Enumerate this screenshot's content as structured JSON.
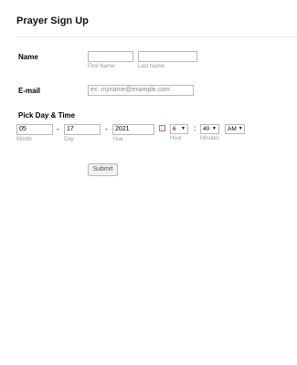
{
  "form": {
    "title": "Prayer Sign Up",
    "name": {
      "label": "Name",
      "first_value": "",
      "last_value": "",
      "first_sublabel": "First Name",
      "last_sublabel": "Last Name"
    },
    "email": {
      "label": "E-mail",
      "placeholder": "ex: myname@example.com"
    },
    "datetime": {
      "label": "Pick Day & Time",
      "month": "05",
      "day": "17",
      "year": "2021",
      "separator": "-",
      "month_sublabel": "Month",
      "day_sublabel": "Day",
      "year_sublabel": "Year",
      "hour": "6",
      "minutes": "40",
      "ampm": "AM",
      "time_separator": ":",
      "hour_sublabel": "Hour",
      "minutes_sublabel": "Minutes",
      "caret": "▼"
    },
    "submit_label": "Submit"
  }
}
